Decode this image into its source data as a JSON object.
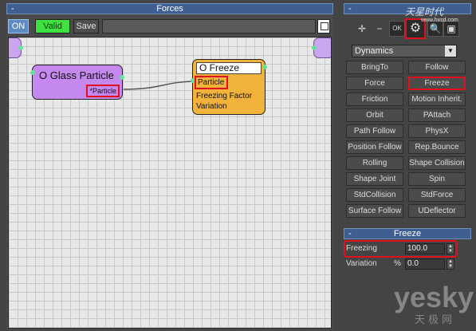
{
  "left_panel": {
    "title": "Forces",
    "collapse": "-",
    "toolbar": {
      "on_label": "ON",
      "valid_label": "Valid",
      "save_label": "Save",
      "name_value": ""
    },
    "nodes": {
      "glass": {
        "title": "O Glass Particle",
        "port_label": "*Particle"
      },
      "freeze": {
        "title": "O Freeze",
        "port_label": "Particle",
        "rows": [
          "Freezing Factor",
          "Variation"
        ]
      }
    }
  },
  "right_panel": {
    "title": "-",
    "icons": [
      "add-icon",
      "minus-icon",
      "ok-icon",
      "gear-icon",
      "search-icon",
      "box-icon"
    ],
    "category": "Dynamics",
    "operators": [
      "BringTo",
      "Follow",
      "Force",
      "Freeze",
      "Friction",
      "Motion Inherit.",
      "Orbit",
      "PAttach",
      "Path Follow",
      "PhysX",
      "Position Follow",
      "Rep.Bounce",
      "Rolling",
      "Shape Collision",
      "Shape Joint",
      "Spin",
      "StdCollision",
      "StdForce",
      "Surface Follow",
      "UDeflector"
    ],
    "selected_operator": "Freeze",
    "freeze_rollout": {
      "title": "Freeze",
      "collapse": "-",
      "freezing_label": "Freezing",
      "freezing_value": "100.0",
      "variation_label": "Variation",
      "variation_unit": "%",
      "variation_value": "0.0"
    }
  },
  "watermark": {
    "top": "天星时代",
    "top_sub": "www.hxsd.com",
    "bottom": "yesky",
    "bottom_cn": "天极网"
  },
  "colors": {
    "title_bar": "#3e5f8f",
    "highlight": "#e0101e",
    "glass_node": "#c488ef",
    "freeze_node": "#f2b33c",
    "valid": "#3fe03f"
  }
}
